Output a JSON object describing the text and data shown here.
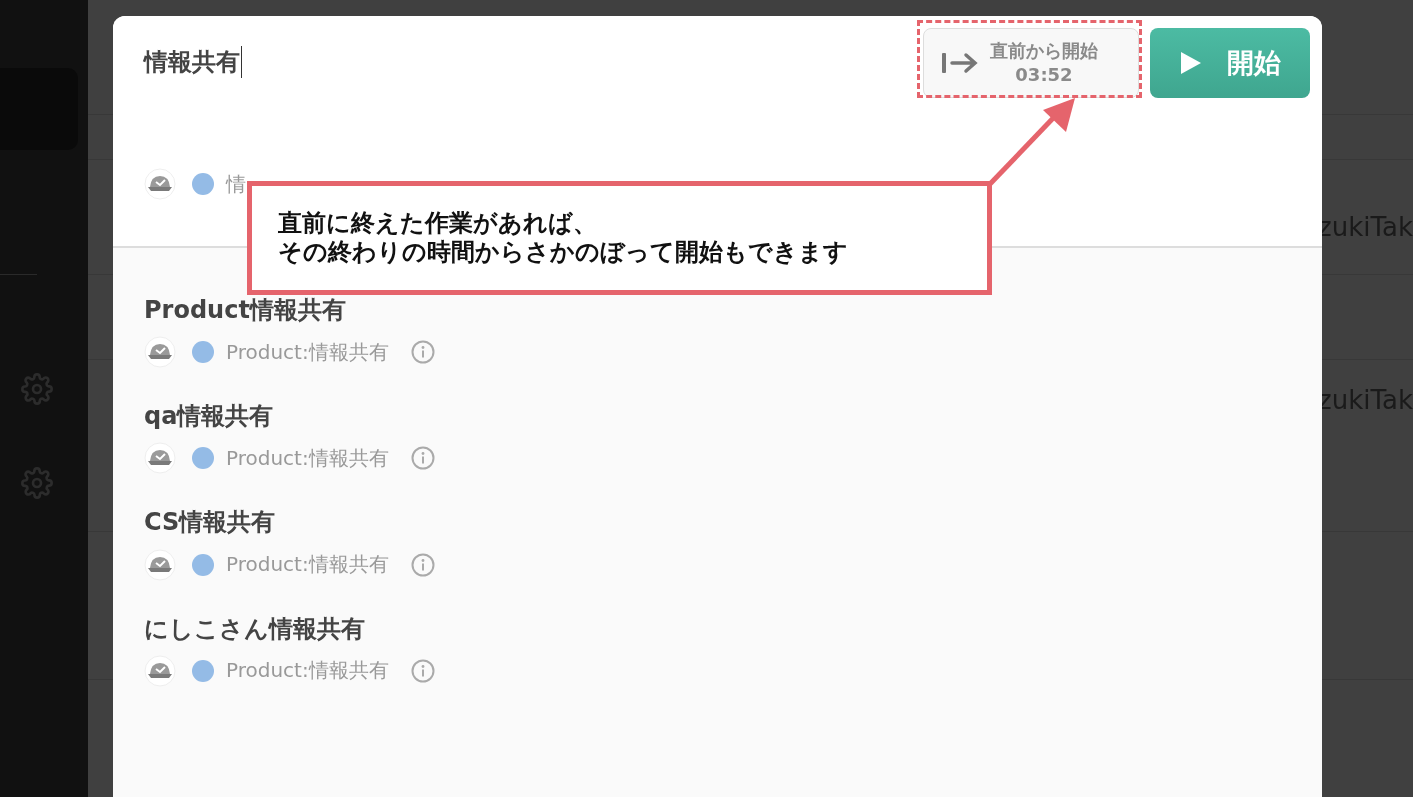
{
  "title_field": {
    "value": "情報共有"
  },
  "resume_button": {
    "label": "直前から開始",
    "time": "03:52"
  },
  "start_button": {
    "label": "開始"
  },
  "current": {
    "project": "情",
    "color": "#94bbe6"
  },
  "items": [
    {
      "title": "Product情報共有",
      "project": "Product:情報共有",
      "color": "#94bbe6"
    },
    {
      "title": "qa情報共有",
      "project": "Product:情報共有",
      "color": "#94bbe6"
    },
    {
      "title": "CS情報共有",
      "project": "Product:情報共有",
      "color": "#94bbe6"
    },
    {
      "title": "にしこさん情報共有",
      "project": "Product:情報共有",
      "color": "#94bbe6"
    }
  ],
  "annotation": {
    "lines": [
      "直前に終えた作業があれば、",
      "その終わりの時間からさかのぼって開始もできます"
    ]
  },
  "background_rows": [
    {
      "text": "zukiTak"
    },
    {
      "text": "zukiTak"
    }
  ]
}
